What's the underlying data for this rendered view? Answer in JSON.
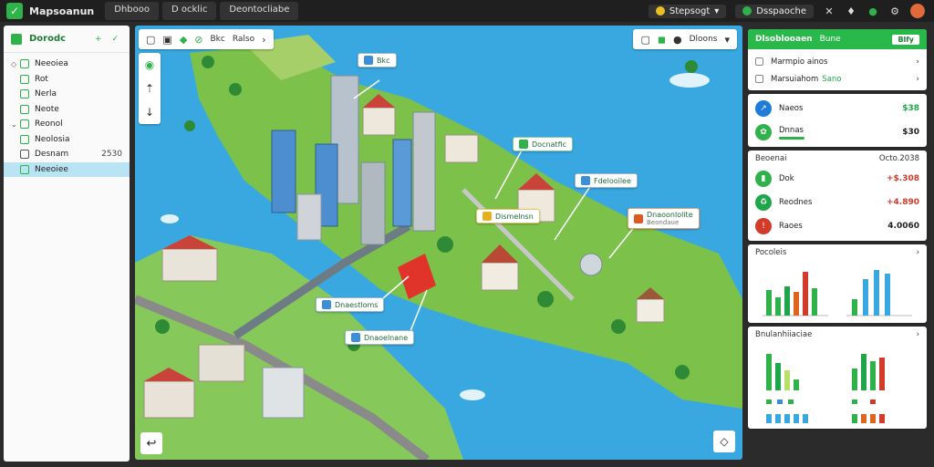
{
  "app": {
    "title": "Mapsoanun",
    "tabs": [
      "Dhbooo",
      "D ocklic",
      "Deontocliabe"
    ],
    "status_label": "Stepsogt",
    "dropdown_label": "Dsspaoche"
  },
  "sidebar": {
    "title": "Dorodc",
    "items": [
      {
        "label": "Neeoiea",
        "caret": "◇",
        "value": ""
      },
      {
        "label": "Rot",
        "caret": "",
        "value": ""
      },
      {
        "label": "Nerla",
        "caret": "",
        "value": ""
      },
      {
        "label": "Neote",
        "caret": "",
        "value": ""
      },
      {
        "label": "Reonol",
        "caret": "⌄",
        "value": ""
      },
      {
        "label": "Neolosia",
        "caret": "",
        "value": ""
      },
      {
        "label": "Desnam",
        "caret": "",
        "value": "2530"
      },
      {
        "label": "Neeoiee",
        "caret": "",
        "value": "",
        "active": true
      }
    ]
  },
  "map": {
    "toolbar_text": "Bkc",
    "toolbar_dropdown": "Ralso",
    "toolbar_right_text": "Dloons",
    "callouts": [
      {
        "id": "c1",
        "title": "Docnatfic",
        "sub": "",
        "color": "#2fb24a"
      },
      {
        "id": "c2",
        "title": "Fdelooilee",
        "sub": "",
        "color": "#3a8fd8"
      },
      {
        "id": "c3",
        "title": "Dismelnsn",
        "sub": "",
        "color": "#e8b020"
      },
      {
        "id": "c4",
        "title": "Dnaoonlolite",
        "sub": "Beondaue",
        "color": "#e05a20"
      },
      {
        "id": "c5",
        "title": "Dnaestloms",
        "sub": "",
        "color": "#3a8fd8"
      },
      {
        "id": "c6",
        "title": "Dnaoelnane",
        "sub": "",
        "color": "#3a8fd8"
      },
      {
        "id": "c7",
        "title": "Bkc",
        "sub": "",
        "color": "#3a8fd8"
      }
    ]
  },
  "panel": {
    "header": {
      "title": "Dlsoblooaen",
      "sub": "Bune",
      "button": "Blfy"
    },
    "list": [
      {
        "label": "Marmpio ainos",
        "accent": ""
      },
      {
        "label": "Marsuiahom",
        "accent": "Sano"
      }
    ],
    "metrics_top": [
      {
        "label": "Naeos",
        "value": "$38",
        "color": "#1e7dd8",
        "vclass": "g"
      },
      {
        "label": "Dnnas",
        "value": "$30",
        "color": "#2fb24a",
        "vclass": "k"
      }
    ],
    "stats_head": {
      "left": "Beoenai",
      "right": "Octo.2038"
    },
    "stats": [
      {
        "label": "Dok",
        "value": "+$.308",
        "color": "#2fb24a",
        "vclass": "r"
      },
      {
        "label": "Reodnes",
        "value": "+4.890",
        "color": "#1fa64a",
        "vclass": "r"
      },
      {
        "label": "Raoes",
        "value": "4.0060",
        "color": "#d23a2a",
        "vclass": "k"
      }
    ],
    "chart_sec1": {
      "title": "Pocoleis"
    },
    "chart_sec2": {
      "title": "Bnulanhiiaciae"
    },
    "accent": "#29b94a"
  }
}
